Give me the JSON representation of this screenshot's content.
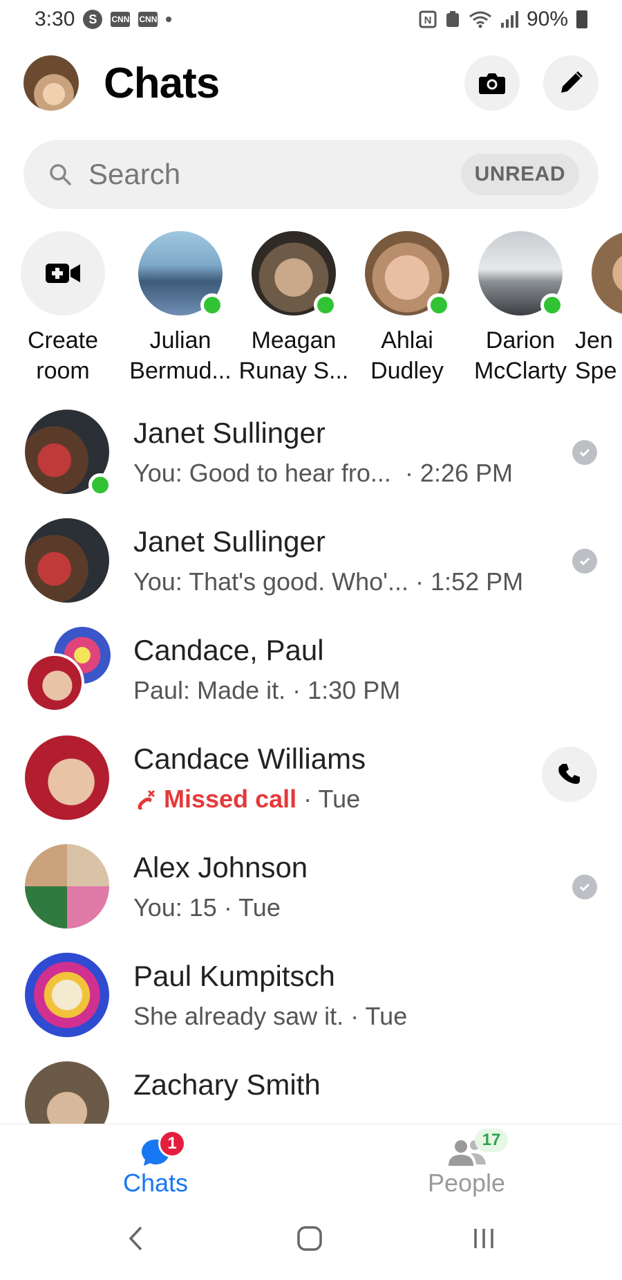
{
  "status_bar": {
    "time": "3:30",
    "battery": "90%",
    "icons": [
      "s-icon",
      "cnn-icon",
      "cnn-icon",
      "dot",
      "nfc-icon",
      "recycle-icon",
      "wifi-icon",
      "signal-icon",
      "battery-icon"
    ]
  },
  "header": {
    "title": "Chats",
    "camera_icon": "camera-icon",
    "compose_icon": "pencil-icon"
  },
  "search": {
    "placeholder": "Search",
    "filter_label": "UNREAD"
  },
  "stories": [
    {
      "line1": "Create",
      "line2": "room",
      "icon": "video-plus-icon"
    },
    {
      "line1": "Julian",
      "line2": "Bermud...",
      "online": true
    },
    {
      "line1": "Meagan",
      "line2": "Runay S...",
      "online": true
    },
    {
      "line1": "Ahlai",
      "line2": "Dudley",
      "online": true
    },
    {
      "line1": "Darion",
      "line2": "McClarty",
      "online": true
    },
    {
      "line1": "Jen",
      "line2": "Spe",
      "online": false
    }
  ],
  "chats": [
    {
      "name": "Janet Sullinger",
      "preview": "You: Good to hear fro...",
      "time": "· 2:26 PM",
      "status": "seen",
      "online": true
    },
    {
      "name": "Janet Sullinger",
      "preview": "You: That's good. Who'...",
      "time": "· 1:52 PM",
      "status": "seen",
      "online": false
    },
    {
      "name": "Candace, Paul",
      "preview": "Paul: Made it.",
      "time": "· 1:30 PM",
      "status": "none",
      "online": false
    },
    {
      "name": "Candace Williams",
      "preview": "Missed call",
      "time": "· Tue",
      "status": "call",
      "online": false
    },
    {
      "name": "Alex Johnson",
      "preview": "You: 15",
      "time": "· Tue",
      "status": "seen",
      "online": false
    },
    {
      "name": "Paul Kumpitsch",
      "preview": "She already saw it.",
      "time": "· Tue",
      "status": "none",
      "online": false
    },
    {
      "name": "Zachary Smith",
      "preview": "",
      "time": "",
      "status": "none",
      "online": false
    }
  ],
  "bottom_nav": {
    "chats_label": "Chats",
    "chats_badge": "1",
    "people_label": "People",
    "people_badge": "17"
  },
  "colors": {
    "accent": "#1877f2",
    "online": "#31c334",
    "missed": "#e5393a",
    "badge": "#e41e3f"
  }
}
